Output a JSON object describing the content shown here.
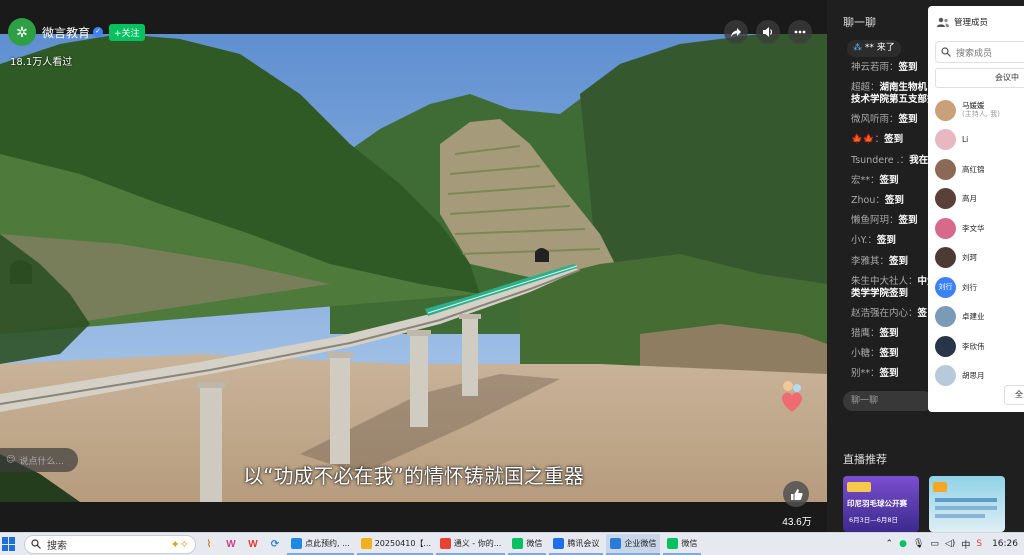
{
  "channel": {
    "name": "微言教育",
    "follow_label": "+关注",
    "viewers": "18.1万人看过"
  },
  "video": {
    "subtitle": "以“功成不必在我”的情怀铸就国之重器",
    "comment_placeholder": "说点什么...",
    "like_count": "43.6万",
    "icons": [
      "share-icon",
      "volume-icon",
      "more-icon",
      "thumbs-up-icon"
    ]
  },
  "chat": {
    "title": "聊一聊",
    "joined_text": "** 来了",
    "messages": [
      {
        "user": "神云若雨：",
        "text": "签到"
      },
      {
        "user": "超超：",
        "text": "湖南生物机电职业技术学院第五支部签到",
        "wrap": true
      },
      {
        "user": "微风听雨：",
        "text": "签到"
      },
      {
        "user": "🍁🍁：",
        "text": "签到"
      },
      {
        "user": "Tsundere .：",
        "text": "我在"
      },
      {
        "user": "宏**：",
        "text": "签到"
      },
      {
        "user": "Zhou：",
        "text": "签到"
      },
      {
        "user": "懒鱼阿玥：",
        "text": "签到"
      },
      {
        "user": "小Y.：",
        "text": "签到"
      },
      {
        "user": "李雅其：",
        "text": "签到"
      },
      {
        "user": "朱生中大社人：",
        "text": "中大社人类学学院签到",
        "wrap": true
      },
      {
        "user": "赵浩强在内心：",
        "text": "签"
      },
      {
        "user": "猎鹰：",
        "text": "签到"
      },
      {
        "user": "小糖：",
        "text": "签到"
      },
      {
        "user": "别**：",
        "text": "签到"
      }
    ],
    "input_placeholder": "聊一聊",
    "recommend_title": "直播推荐",
    "rec_cards": [
      {
        "line1": "印尼羽毛球公开赛",
        "line2": "6月3日—6月8日"
      },
      {
        "line1": "",
        "line2": ""
      }
    ]
  },
  "members": {
    "title": "管理成员",
    "search_placeholder": "搜索成员",
    "tab_label": "会议中",
    "list": [
      {
        "name": "马媛媛",
        "sub": "(主持人, 我)",
        "avatar_color": "#c9a07a"
      },
      {
        "name": "Li",
        "sub": "",
        "avatar_color": "#e8b8c2"
      },
      {
        "name": "高红锦",
        "sub": "",
        "avatar_color": "#8a6a55"
      },
      {
        "name": "高月",
        "sub": "",
        "avatar_color": "#5a4038"
      },
      {
        "name": "李文华",
        "sub": "",
        "avatar_color": "#d76a8a"
      },
      {
        "name": "刘珂",
        "sub": "",
        "avatar_color": "#4d3a34"
      },
      {
        "name": "刘行",
        "sub": "",
        "avatar_color": "#3b82f6",
        "initials": "刘行"
      },
      {
        "name": "卓建业",
        "sub": "",
        "avatar_color": "#7a9bb8"
      },
      {
        "name": "李欣伟",
        "sub": "",
        "avatar_color": "#27344a"
      },
      {
        "name": "胡思月",
        "sub": "",
        "avatar_color": "#b9c9dc"
      }
    ],
    "button_label": "全"
  },
  "taskbar": {
    "search_text": "搜索",
    "apps": [
      {
        "label": "点此预约, ...",
        "color": "#1e88e5"
      },
      {
        "label": "20250410【...",
        "color": "#f2b01e"
      },
      {
        "label": "通义 - 你的...",
        "color": "#e94235"
      },
      {
        "label": "微信",
        "color": "#07c160"
      },
      {
        "label": "腾讯会议",
        "color": "#1c6fe8"
      },
      {
        "label": "企业微信",
        "color": "#2b7bd8"
      },
      {
        "label": "微信",
        "color": "#07c160"
      }
    ],
    "tray_lang": "中",
    "clock": "16:26"
  }
}
